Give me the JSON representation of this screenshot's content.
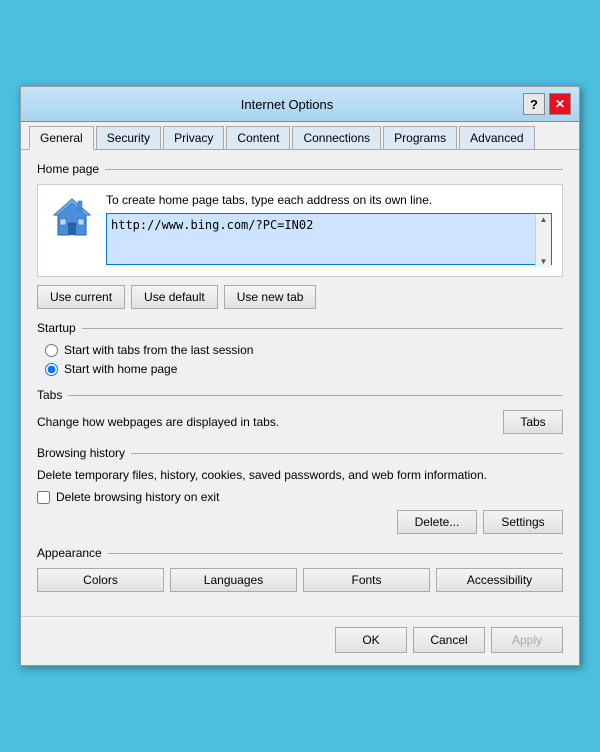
{
  "window": {
    "title": "Internet Options",
    "help_symbol": "?",
    "close_symbol": "✕"
  },
  "tabs": [
    {
      "label": "General",
      "active": true
    },
    {
      "label": "Security",
      "active": false
    },
    {
      "label": "Privacy",
      "active": false
    },
    {
      "label": "Content",
      "active": false
    },
    {
      "label": "Connections",
      "active": false
    },
    {
      "label": "Programs",
      "active": false
    },
    {
      "label": "Advanced",
      "active": false
    }
  ],
  "sections": {
    "homepage": {
      "title": "Home page",
      "description": "To create home page tabs, type each address on its own line.",
      "url": "http://www.bing.com/?PC=IN02"
    },
    "homepage_buttons": {
      "use_current": "Use current",
      "use_default": "Use default",
      "use_new_tab": "Use new tab"
    },
    "startup": {
      "title": "Startup",
      "option1": "Start with tabs from the last session",
      "option2": "Start with home page"
    },
    "tabs_section": {
      "title": "Tabs",
      "description": "Change how webpages are displayed in tabs.",
      "button": "Tabs"
    },
    "browsing_history": {
      "title": "Browsing history",
      "description": "Delete temporary files, history, cookies, saved passwords, and web form information.",
      "checkbox_label": "Delete browsing history on exit",
      "delete_btn": "Delete...",
      "settings_btn": "Settings"
    },
    "appearance": {
      "title": "Appearance",
      "colors_btn": "Colors",
      "languages_btn": "Languages",
      "fonts_btn": "Fonts",
      "accessibility_btn": "Accessibility"
    }
  },
  "bottom_buttons": {
    "ok": "OK",
    "cancel": "Cancel",
    "apply": "Apply"
  }
}
